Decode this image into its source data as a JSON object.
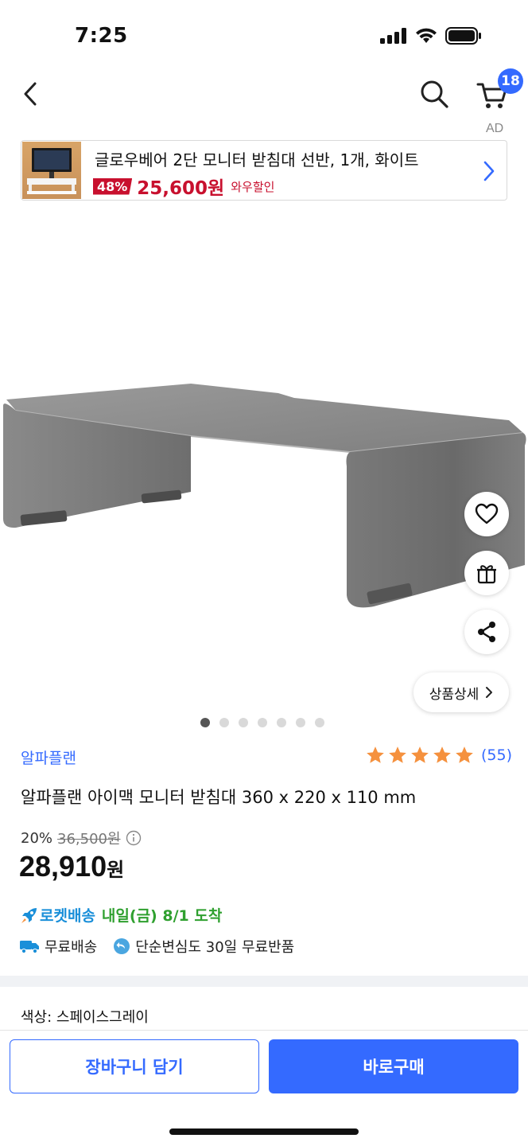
{
  "status_bar": {
    "time": "7:25"
  },
  "nav": {
    "cart_count": "18"
  },
  "ad": {
    "label": "AD",
    "title": "글로우베어 2단 모니터 받침대 선반, 1개, 화이트",
    "discount": "48%",
    "price": "25,600원",
    "wow": "와우할인"
  },
  "gallery": {
    "image_count": 7,
    "active_index": 0,
    "detail_label": "상품상세"
  },
  "product": {
    "brand": "알파플랜",
    "rating_stars": 5,
    "rating_count": "(55)",
    "title": "알파플랜 아이맥 모니터 받침대 360 x 220 x 110 mm",
    "discount_rate": "20%",
    "original_price": "36,500원",
    "final_price": "28,910",
    "currency": "원"
  },
  "delivery": {
    "rocket_label": "로켓배송",
    "arrival": "내일(금) 8/1 도착",
    "free_shipping": "무료배송",
    "free_return": "단순변심도 30일 무료반품"
  },
  "option": {
    "label": "색상: 스페이스그레이"
  },
  "actions": {
    "add_to_cart": "장바구니 담기",
    "buy_now": "바로구매"
  },
  "colors": {
    "accent": "#346aff",
    "sale": "#c8102e",
    "star": "#f5913e",
    "delivery": "#2fa02f"
  }
}
